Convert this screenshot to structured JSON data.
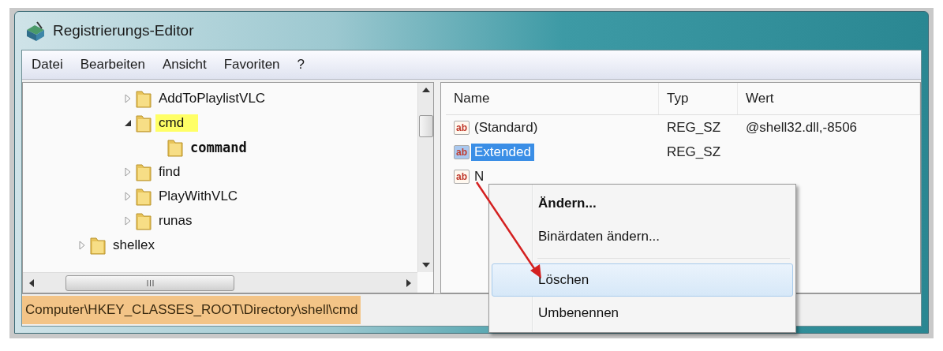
{
  "window": {
    "title": "Registrierungs-Editor"
  },
  "menu_bar": [
    "Datei",
    "Bearbeiten",
    "Ansicht",
    "Favoriten",
    "?"
  ],
  "tree": {
    "items": [
      {
        "label": "AddToPlaylistVLC",
        "expanded": false,
        "highlighted": false,
        "bold": false
      },
      {
        "label": "cmd",
        "expanded": true,
        "highlighted": true,
        "bold": false,
        "children": [
          {
            "label": "command",
            "highlighted": false,
            "bold": true
          }
        ]
      },
      {
        "label": "find",
        "expanded": false,
        "highlighted": false,
        "bold": false
      },
      {
        "label": "PlayWithVLC",
        "expanded": false,
        "highlighted": false,
        "bold": false
      },
      {
        "label": "runas",
        "expanded": false,
        "highlighted": false,
        "bold": false
      }
    ],
    "outer_items": [
      {
        "label": "shellex",
        "expanded": false,
        "highlighted": false,
        "bold": false
      }
    ]
  },
  "values": {
    "columns": [
      "Name",
      "Typ",
      "Wert"
    ],
    "rows": [
      {
        "icon_label": "ab",
        "name": "(Standard)",
        "type": "REG_SZ",
        "value": "@shell32.dll,-8506",
        "selected": false
      },
      {
        "icon_label": "ab",
        "name": "Extended",
        "type": "REG_SZ",
        "selected": true
      },
      {
        "icon_label": "ab",
        "name": "N",
        "selected": false
      }
    ]
  },
  "context_menu": [
    {
      "kind": "item",
      "label": "Ändern...",
      "default": true,
      "selected": false
    },
    {
      "kind": "item",
      "label": "Binärdaten ändern...",
      "default": false,
      "selected": false
    },
    {
      "kind": "separator"
    },
    {
      "kind": "item",
      "label": "Löschen",
      "default": false,
      "selected": true
    },
    {
      "kind": "item",
      "label": "Umbenennen",
      "default": false,
      "selected": false
    }
  ],
  "status_bar": {
    "path": "Computer\\HKEY_CLASSES_ROOT\\Directory\\shell\\cmd"
  }
}
